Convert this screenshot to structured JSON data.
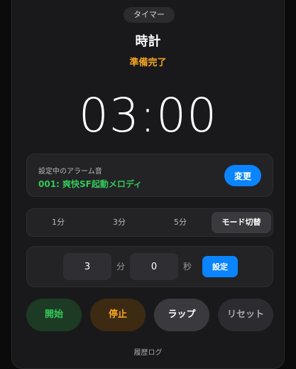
{
  "header": {
    "tab_label": "タイマー",
    "title": "時計",
    "status": "準備完了"
  },
  "clock": {
    "display": "03:00"
  },
  "alarm": {
    "label": "設定中のアラーム音",
    "name": "001: 爽快SF起動メロディ",
    "change_label": "変更"
  },
  "modes": {
    "items": [
      {
        "label": "1分"
      },
      {
        "label": "3分"
      },
      {
        "label": "5分"
      },
      {
        "label": "モード切替"
      }
    ],
    "active_index": 3
  },
  "setter": {
    "minutes_value": "3",
    "minutes_unit": "分",
    "seconds_value": "0",
    "seconds_unit": "秒",
    "set_label": "設定"
  },
  "controls": {
    "start_label": "開始",
    "stop_label": "停止",
    "lap_label": "ラップ",
    "reset_label": "リセット"
  },
  "footer": {
    "history_label": "履歴ログ"
  },
  "colors": {
    "accent_blue": "#0a84ff",
    "status_orange": "#f5a623",
    "alarm_green": "#34c759"
  }
}
